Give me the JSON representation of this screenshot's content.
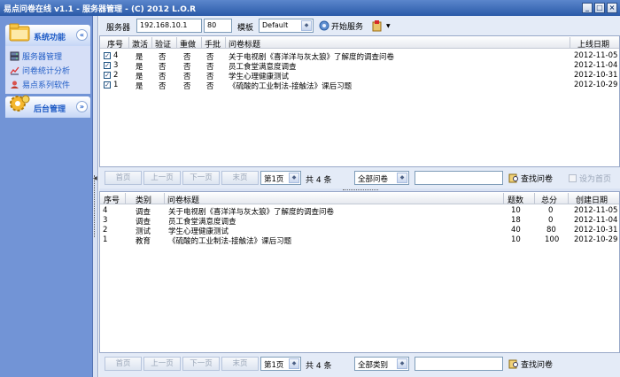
{
  "window": {
    "title": "易点问卷在线 v1.1 - 服务器管理 - (C) 2012 L.O.R",
    "buttons": [
      "_",
      "□",
      "×"
    ]
  },
  "sidebar": {
    "group1": {
      "title": "系统功能",
      "items": [
        {
          "label": "服务器管理",
          "icon": "server-icon"
        },
        {
          "label": "问卷统计分析",
          "icon": "chart-icon"
        },
        {
          "label": "易点系列软件",
          "icon": "software-icon"
        }
      ]
    },
    "group2": {
      "title": "后台管理"
    }
  },
  "toolbar": {
    "server_label": "服务器",
    "server_ip": "192.168.10.1",
    "port": "80",
    "template_label": "模板",
    "template_value": "Default",
    "start_label": "开始服务"
  },
  "table1": {
    "columns": [
      "序号",
      "激活",
      "验证",
      "重做",
      "手批",
      "问卷标题",
      "上线日期"
    ],
    "rows": [
      {
        "no": "4",
        "active": "是",
        "verify": "否",
        "redo": "否",
        "manual": "否",
        "title": "关于电视剧《喜洋洋与灰太狼》了解度的调查问卷",
        "date": "2012-11-05"
      },
      {
        "no": "3",
        "active": "是",
        "verify": "否",
        "redo": "否",
        "manual": "否",
        "title": "员工食堂满意度调查",
        "date": "2012-11-04"
      },
      {
        "no": "2",
        "active": "是",
        "verify": "否",
        "redo": "否",
        "manual": "否",
        "title": "学生心理健康测试",
        "date": "2012-10-31"
      },
      {
        "no": "1",
        "active": "是",
        "verify": "否",
        "redo": "否",
        "manual": "否",
        "title": "《硫酸的工业制法-接触法》课后习题",
        "date": "2012-10-29"
      }
    ]
  },
  "pager1": {
    "first": "首页",
    "prev": "上一页",
    "next": "下一页",
    "last": "末页",
    "page": "第1页",
    "total": "共 4 条",
    "filter": "全部问卷",
    "find": "查找问卷",
    "set_home": "设为首页"
  },
  "table2": {
    "columns": [
      "序号",
      "类别",
      "问卷标题",
      "题数",
      "总分",
      "创建日期"
    ],
    "rows": [
      {
        "no": "4",
        "cat": "调查",
        "title": "关于电视剧《喜洋洋与灰太狼》了解度的调查问卷",
        "qcount": "10",
        "score": "0",
        "date": "2012-11-05"
      },
      {
        "no": "3",
        "cat": "调查",
        "title": "员工食堂满意度调查",
        "qcount": "18",
        "score": "0",
        "date": "2012-11-04"
      },
      {
        "no": "2",
        "cat": "测试",
        "title": "学生心理健康测试",
        "qcount": "40",
        "score": "80",
        "date": "2012-10-31"
      },
      {
        "no": "1",
        "cat": "教育",
        "title": "《硫酸的工业制法-接触法》课后习题",
        "qcount": "10",
        "score": "100",
        "date": "2012-10-29"
      }
    ]
  },
  "pager2": {
    "first": "首页",
    "prev": "上一页",
    "next": "下一页",
    "last": "末页",
    "page": "第1页",
    "total": "共 4 条",
    "filter": "全部类别",
    "find": "查找问卷"
  },
  "colors": {
    "titlebar": "#2a5aa8",
    "sidebar": "#7294d6",
    "accent_text": "#215dc6",
    "panel_bg": "#e4ebf7"
  }
}
